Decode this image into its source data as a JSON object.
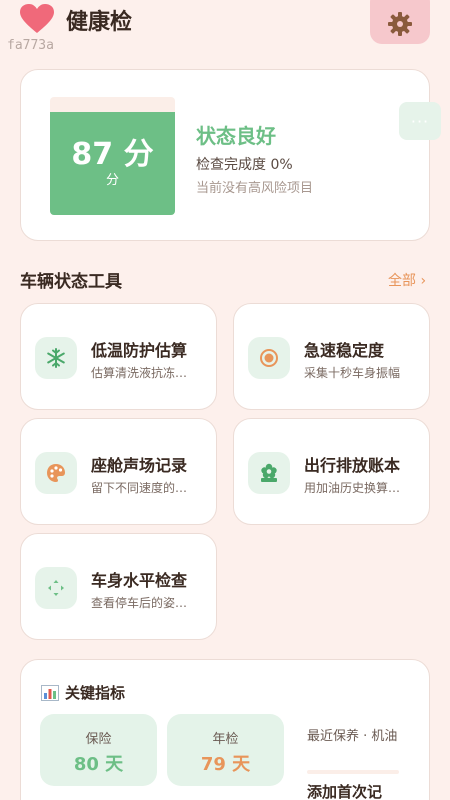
{
  "header": {
    "title": "健康检",
    "subtitle": "fa773a",
    "heart_icon": "heart-icon",
    "settings_icon": "gear-icon",
    "colors": {
      "heart": "#f0697a",
      "settings_bg": "#f6c8cc",
      "gear": "#8a5a3c"
    }
  },
  "status": {
    "score_text": "87 分",
    "score_unit": "分",
    "score_level": 0.87,
    "title": "状态良好",
    "progress": "检查完成度 0%",
    "risk": "当前没有高风险项目",
    "more_label": "···",
    "colors": {
      "good": "#6dbf86"
    }
  },
  "tools_section": {
    "title": "车辆状态工具",
    "all_label": "全部 ›",
    "items": [
      {
        "title": "低温防护估算",
        "desc": "估算清洗液抗冻…",
        "icon": "snowflake-icon"
      },
      {
        "title": "急速稳定度",
        "desc": "采集十秒车身振幅",
        "icon": "target-icon"
      },
      {
        "title": "座舱声场记录",
        "desc": "留下不同速度的…",
        "icon": "palette-icon"
      },
      {
        "title": "出行排放账本",
        "desc": "用加油历史换算…",
        "icon": "flower-icon"
      },
      {
        "title": "车身水平检查",
        "desc": "查看停车后的姿…",
        "icon": "move-arrows-icon"
      }
    ]
  },
  "metrics": {
    "title": "关键指标",
    "title_icon": "bar-chart-icon",
    "insurance": {
      "label": "保险",
      "value": "80 天",
      "color": "#6dbf86",
      "bg": "#e4f3e9"
    },
    "inspection": {
      "label": "年检",
      "value": "79 天",
      "color": "#e8955a",
      "bg": "#e4f3e9"
    },
    "recent": {
      "label": "最近保养 · 机油",
      "value": "添加首次记"
    }
  }
}
